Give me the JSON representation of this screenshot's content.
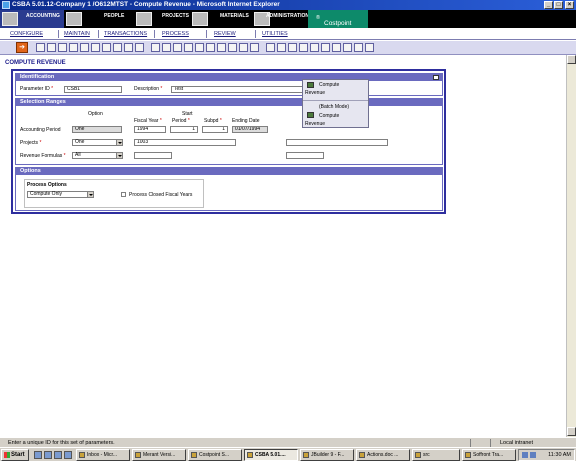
{
  "window": {
    "title": "CSBA 5.01.12-Company 1 /O612MTST - Compute Revenue - Microsoft Internet Explorer",
    "min_glyph": "_",
    "max_glyph": "□",
    "close_glyph": "×"
  },
  "menubar": {
    "tabs": [
      {
        "label": "ACCOUNTING"
      },
      {
        "label": "PEOPLE"
      },
      {
        "label": "PROJECTS"
      },
      {
        "label": "MATERIALS"
      },
      {
        "label": "ADMINISTRATION"
      }
    ],
    "brand": "Costpoint",
    "brand_mark": "®"
  },
  "submenu": {
    "items": [
      "CONFIGURE",
      "MAINTAIN",
      "TRANSACTIONS",
      "PROCESS",
      "REVIEW",
      "UTILITIES"
    ]
  },
  "toolbar": {
    "execute_glyph": "➔",
    "icons": [
      "new-icon",
      "save-icon",
      "copy-icon",
      "delete-icon",
      "first-icon",
      "prev-icon",
      "next-icon",
      "last-icon",
      "query-icon",
      "print-icon",
      "help-icon",
      "find-icon",
      "filter-icon",
      "sort-icon",
      "refresh-icon",
      "lock-icon",
      "export-icon",
      "report-icon",
      "attach-icon",
      "notes-icon",
      "table-icon",
      "properties-icon",
      "edit-icon",
      "browse-icon",
      "detail-icon",
      "zoom-icon",
      "calendar-icon",
      "mail-icon",
      "close-icon",
      "settings-icon"
    ]
  },
  "page": {
    "heading": "COMPUTE REVENUE"
  },
  "identification": {
    "header": "Identification",
    "param_id_label": "Parameter ID",
    "param_id_value": "CSB1",
    "description_label": "Description",
    "description_value": "Test"
  },
  "popup_menu": {
    "item1_line1": "Compute",
    "item1_line2": "Revenue",
    "batch_label": "(Batch Mode)",
    "item2_line1": "Compute",
    "item2_line2": "Revenue"
  },
  "selection_ranges": {
    "header": "Selection Ranges",
    "col_option": "Option",
    "col_fiscal_year": "Fiscal Year",
    "col_start": "Start",
    "col_period": "Period",
    "col_subpd": "Subpd",
    "col_ending_date": "Ending Date",
    "accounting_period": {
      "label": "Accounting Period",
      "option": "One",
      "fiscal_year": "1994",
      "period": "1",
      "subpd": "1",
      "ending_date": "01/07/1994"
    },
    "projects": {
      "label": "Projects",
      "option": "One",
      "value": "1003",
      "end_value": ""
    },
    "revenue_formulas": {
      "label": "Revenue Formulas",
      "option": "All",
      "value": "",
      "end_value": ""
    }
  },
  "options": {
    "header": "Options",
    "process_options_label": "Process Options",
    "process_options_value": "Compute Only",
    "process_closed_label": "Process Closed Fiscal Years",
    "process_closed_checked": false
  },
  "statusbar": {
    "message": "Enter a unique ID for this set of parameters.",
    "zone": "Local intranet"
  },
  "taskbar": {
    "start": "Start",
    "tasks": [
      {
        "label": "Inbox - Micr..."
      },
      {
        "label": "Merant Versi..."
      },
      {
        "label": "Costpoint S..."
      },
      {
        "label": "CSBA 5.01...."
      },
      {
        "label": "JBuilder 9 - F..."
      },
      {
        "label": "Actions.doc ..."
      },
      {
        "label": "src"
      },
      {
        "label": "Soffront Tra..."
      }
    ],
    "clock": "11:30 AM"
  }
}
